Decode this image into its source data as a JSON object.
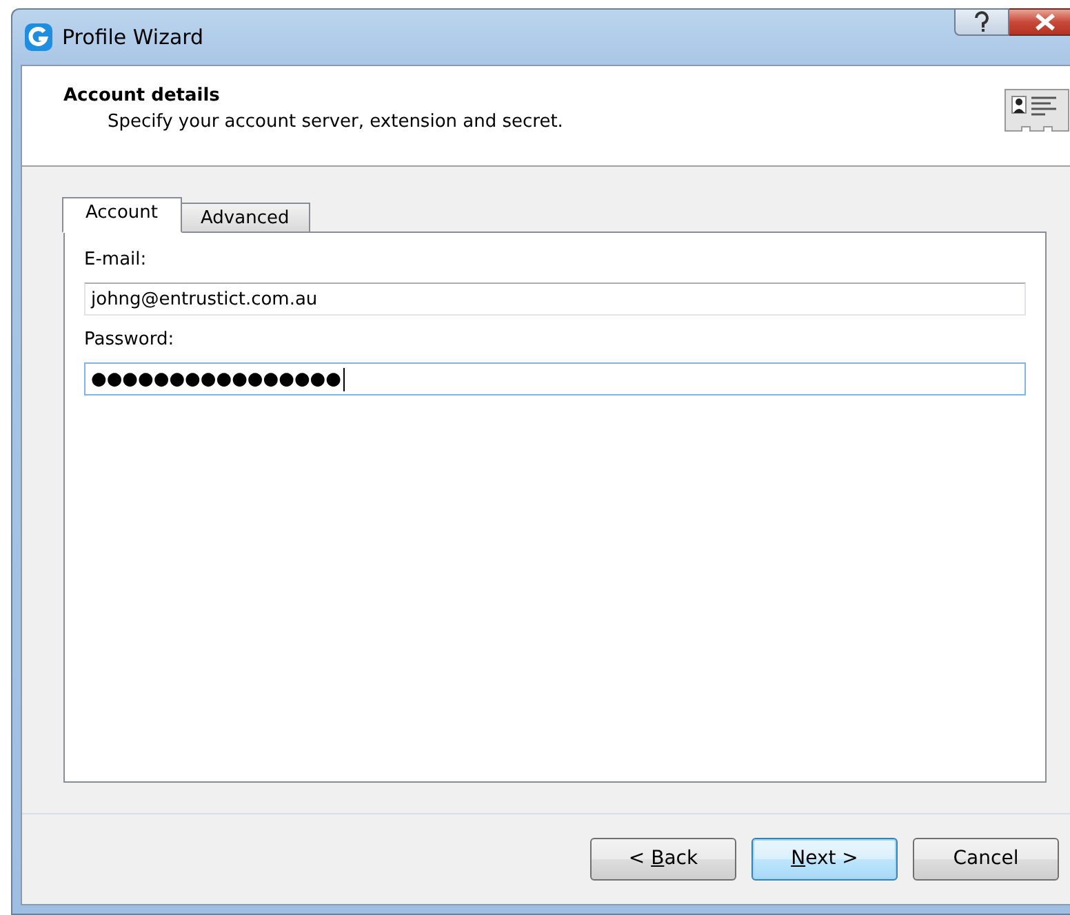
{
  "window": {
    "title": "Profile Wizard"
  },
  "header": {
    "title": "Account details",
    "subtitle": "Specify your account server, extension and secret."
  },
  "tabs": [
    {
      "label": "Account",
      "selected": true
    },
    {
      "label": "Advanced",
      "selected": false
    }
  ],
  "fields": [
    {
      "label": "E-mail:",
      "value": "johng@entrustict.com.au",
      "focused": false
    },
    {
      "label": "Password:",
      "value": "●●●●●●●●●●●●●●●●",
      "focused": true
    }
  ],
  "buttons": [
    {
      "before": "< ",
      "key": "B",
      "after": "ack",
      "default": false
    },
    {
      "key": "N",
      "after": "ext >",
      "default": true
    },
    {
      "before": "Cancel",
      "default": false
    }
  ]
}
